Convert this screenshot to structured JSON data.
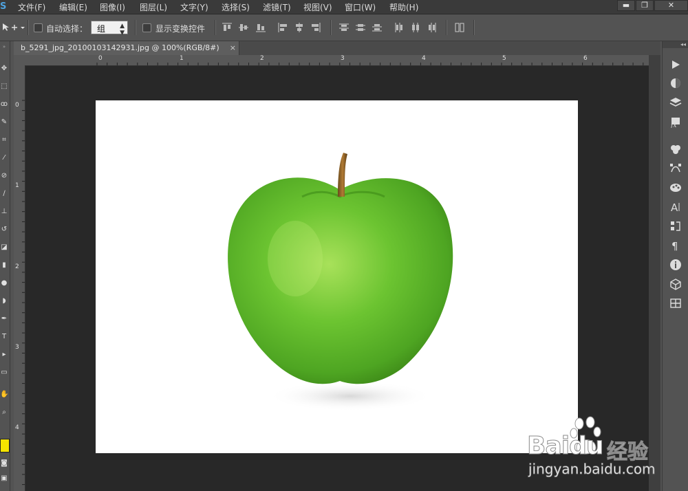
{
  "menu": {
    "logo": "S",
    "items": [
      "文件(F)",
      "编辑(E)",
      "图像(I)",
      "图层(L)",
      "文字(Y)",
      "选择(S)",
      "滤镜(T)",
      "视图(V)",
      "窗口(W)",
      "帮助(H)"
    ],
    "window_buttons": {
      "minimize": "▬",
      "restore": "❐",
      "close": "✕"
    }
  },
  "options": {
    "auto_select_label": "自动选择：",
    "auto_select_value": "组",
    "show_transform_label": "显示变换控件"
  },
  "document": {
    "tab_title": "b_5291_jpg_20100103142931.jpg @ 100%(RGB/8#)",
    "tab_close": "×"
  },
  "ruler": {
    "h_labels": [
      "0",
      "1",
      "2",
      "3",
      "4",
      "5",
      "6"
    ],
    "v_labels": [
      "0",
      "1",
      "2",
      "3",
      "4"
    ]
  },
  "watermark": {
    "brand": "Baidu",
    "brand_cn": "经验",
    "url": "jingyan.baidu.com"
  },
  "colors": {
    "apple_green": "#6cc431",
    "foreground_swatch": "#f5e400"
  }
}
